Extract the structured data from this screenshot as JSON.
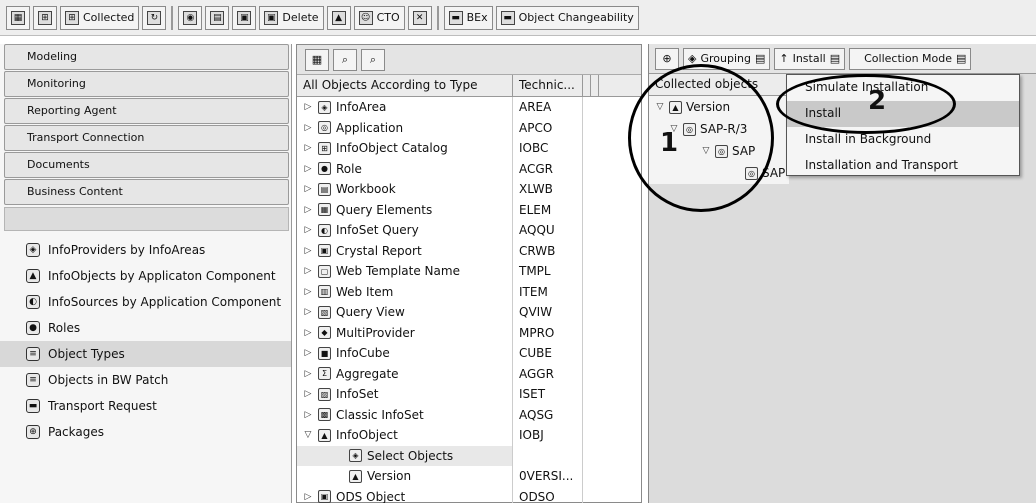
{
  "toolbar": {
    "collected_label": "Collected",
    "delete_label": "Delete",
    "cto_label": "CTO",
    "bex_label": "BEx",
    "object_changeability_label": "Object Changeability"
  },
  "nav": {
    "buttons": [
      {
        "label": "Modeling"
      },
      {
        "label": "Monitoring"
      },
      {
        "label": "Reporting Agent"
      },
      {
        "label": "Transport Connection"
      },
      {
        "label": "Documents"
      },
      {
        "label": "Business Content"
      }
    ],
    "items": [
      {
        "label": "InfoProviders by InfoAreas",
        "icon": "infoprovider-icon"
      },
      {
        "label": "InfoObjects by Applicaton Component",
        "icon": "infoobject-icon"
      },
      {
        "label": "InfoSources by Application Component",
        "icon": "infosource-icon"
      },
      {
        "label": "Roles",
        "icon": "roles-icon"
      },
      {
        "label": "Object Types",
        "icon": "object-types-icon",
        "selected": true
      },
      {
        "label": "Objects in BW Patch",
        "icon": "patch-icon"
      },
      {
        "label": "Transport Request",
        "icon": "transport-request-icon"
      },
      {
        "label": "Packages",
        "icon": "packages-icon"
      }
    ]
  },
  "objects": {
    "col1": "All Objects According to Type",
    "col2": "Technic...",
    "rows": [
      {
        "name": "InfoArea",
        "tech": "AREA",
        "icon": "infoarea-icon"
      },
      {
        "name": "Application",
        "tech": "APCO",
        "icon": "application-icon"
      },
      {
        "name": "InfoObject Catalog",
        "tech": "IOBC",
        "icon": "catalog-icon"
      },
      {
        "name": "Role",
        "tech": "ACGR",
        "icon": "role-icon"
      },
      {
        "name": "Workbook",
        "tech": "XLWB",
        "icon": "workbook-icon"
      },
      {
        "name": "Query Elements",
        "tech": "ELEM",
        "icon": "query-elements-icon"
      },
      {
        "name": "InfoSet Query",
        "tech": "AQQU",
        "icon": "infoset-query-icon"
      },
      {
        "name": "Crystal Report",
        "tech": "CRWB",
        "icon": "crystal-report-icon"
      },
      {
        "name": "Web Template Name",
        "tech": "TMPL",
        "icon": "web-template-icon"
      },
      {
        "name": "Web Item",
        "tech": "ITEM",
        "icon": "web-item-icon"
      },
      {
        "name": "Query View",
        "tech": "QVIW",
        "icon": "query-view-icon"
      },
      {
        "name": "MultiProvider",
        "tech": "MPRO",
        "icon": "multiprovider-icon"
      },
      {
        "name": "InfoCube",
        "tech": "CUBE",
        "icon": "infocube-icon"
      },
      {
        "name": "Aggregate",
        "tech": "AGGR",
        "icon": "aggregate-icon"
      },
      {
        "name": "InfoSet",
        "tech": "ISET",
        "icon": "infoset-icon"
      },
      {
        "name": "Classic InfoSet",
        "tech": "AQSG",
        "icon": "classic-infoset-icon"
      },
      {
        "name": "InfoObject",
        "tech": "IOBJ",
        "icon": "infoobject-icon",
        "expanded": true
      },
      {
        "name": "Select Objects",
        "tech": "",
        "icon": "select-objects-icon",
        "child": true,
        "highlight": true
      },
      {
        "name": "Version",
        "tech": "0VERSI...",
        "icon": "version-icon",
        "child": true
      },
      {
        "name": "ODS Object",
        "tech": "ODSO",
        "icon": "ods-icon"
      }
    ]
  },
  "collected": {
    "grouping_label": "Grouping",
    "install_label": "Install",
    "collection_mode_label": "Collection Mode",
    "header": "Collected objects",
    "tree": [
      {
        "label": "Version",
        "level": 0
      },
      {
        "label": "SAP-R/3",
        "level": 1
      },
      {
        "label": "SAP",
        "level": 2
      },
      {
        "label": "SAP",
        "level": 3
      }
    ]
  },
  "install_menu": {
    "items": [
      {
        "label": "Simulate Installation"
      },
      {
        "label": "Install",
        "selected": true
      },
      {
        "label": "Install in Background"
      },
      {
        "label": "Installation and Transport"
      }
    ]
  },
  "annotations": {
    "callout_1": "1",
    "callout_2": "2"
  }
}
